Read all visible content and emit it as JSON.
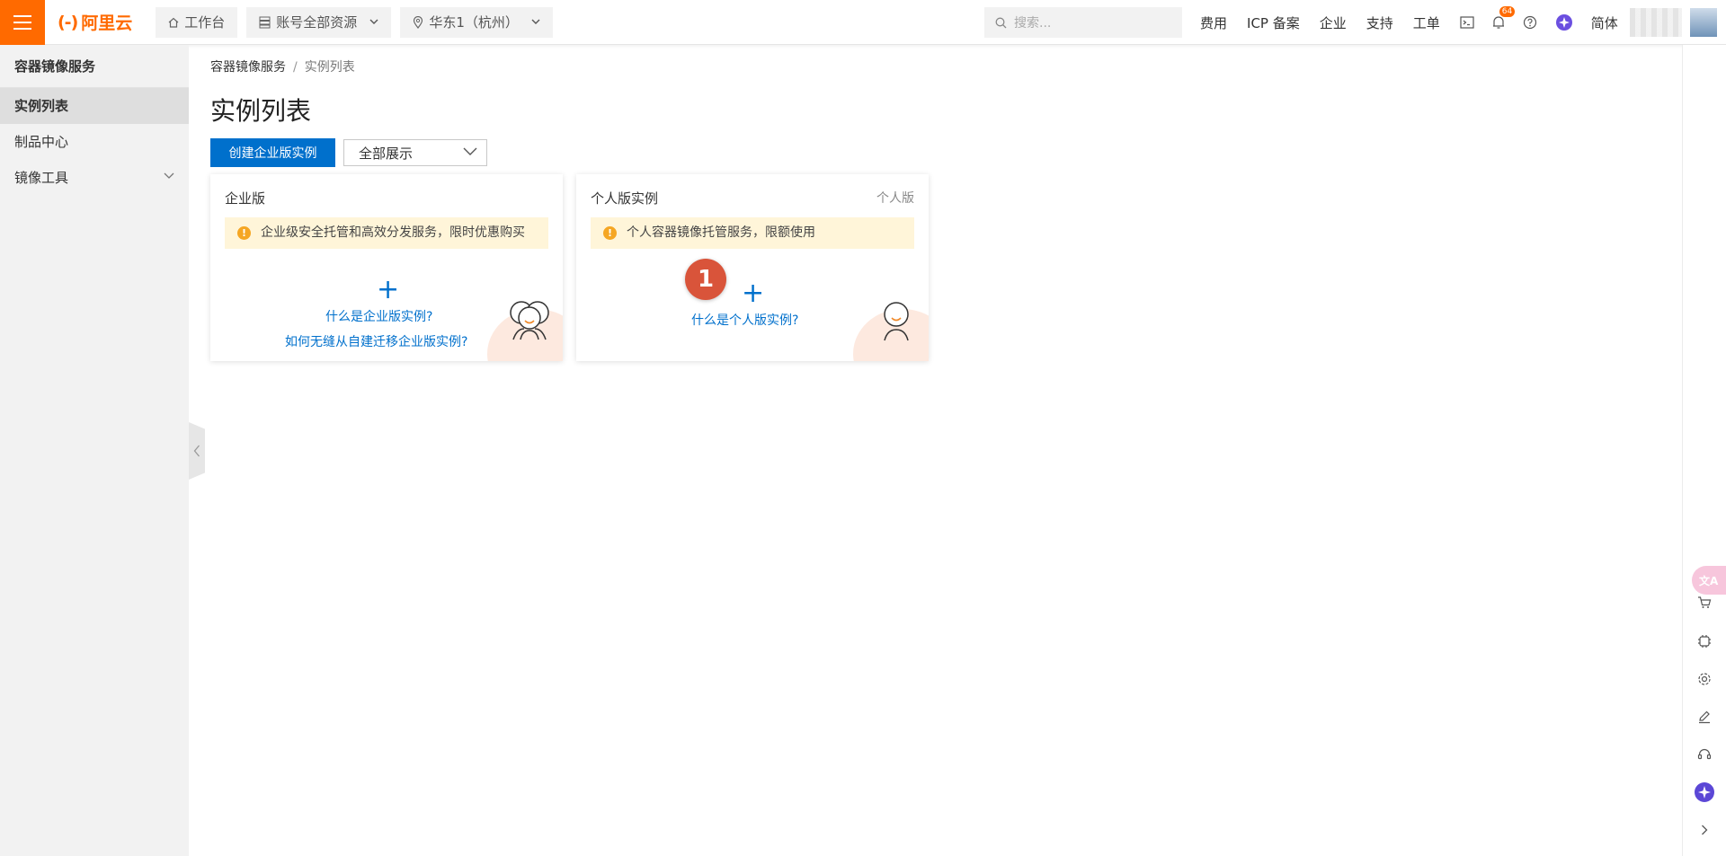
{
  "header": {
    "logo_text": "阿里云",
    "logo_mark": "(-)",
    "workbench": "工作台",
    "account_resources": "账号全部资源",
    "region": "华东1（杭州）",
    "search_placeholder": "搜索...",
    "links": [
      "费用",
      "ICP 备案",
      "企业",
      "支持",
      "工单"
    ],
    "notification_count": "64",
    "language": "简体",
    "brand_color": "#ff6a00"
  },
  "sidebar": {
    "title": "容器镜像服务",
    "items": [
      {
        "label": "实例列表",
        "active": true
      },
      {
        "label": "制品中心",
        "active": false
      },
      {
        "label": "镜像工具",
        "active": false,
        "expandable": true
      }
    ]
  },
  "main": {
    "breadcrumb": {
      "root": "容器镜像服务",
      "separator": "/",
      "current": "实例列表"
    },
    "title": "实例列表",
    "create_button": "创建企业版实例",
    "filter_select": "全部展示",
    "cards": {
      "enterprise": {
        "title": "企业版",
        "notice": "企业级安全托管和高效分发服务，限时优惠购买",
        "plus": "+",
        "link1": "什么是企业版实例?",
        "link2": "如何无缝从自建迁移企业版实例?"
      },
      "personal": {
        "title": "个人版实例",
        "tag": "个人版",
        "notice": "个人容器镜像托管服务，限额使用",
        "plus": "+",
        "link1": "什么是个人版实例?"
      }
    },
    "step_badge": "1",
    "accent_color": "#0070cc"
  },
  "right_rail": {
    "translate_label": "文A",
    "icons": [
      "cart-icon",
      "compute-icon",
      "gear-icon",
      "edit-icon",
      "headset-icon",
      "assistant-icon",
      "chevron-right-icon"
    ]
  }
}
